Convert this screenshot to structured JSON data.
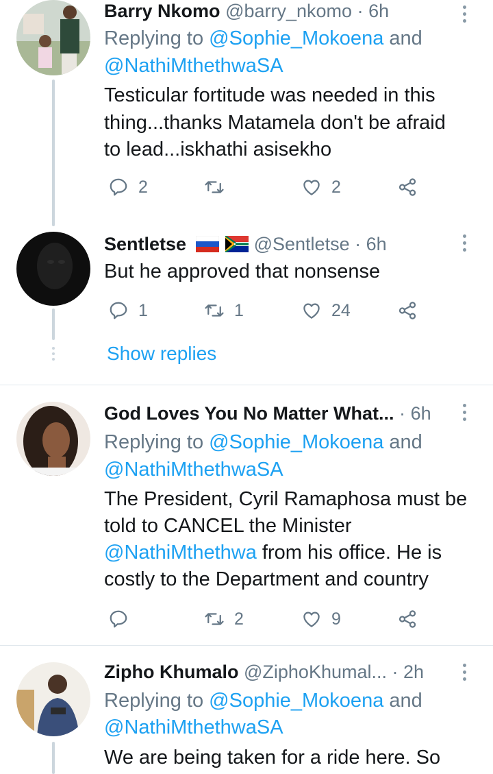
{
  "tweets": [
    {
      "name": "Barry Nkomo",
      "handle": "@barry_nkomo",
      "time": "6h",
      "reply_prefix": "Replying to",
      "reply_to_1": "@Sophie_Mokoena",
      "reply_and": "and",
      "reply_to_2": "@NathiMthethwaSA",
      "text_lines": [
        "Testicular fortitude was needed in this",
        "thing...thanks Matamela don't be afraid",
        "to lead...iskhathi asisekho"
      ],
      "replies": "2",
      "retweets": "",
      "likes": "2"
    },
    {
      "name": "Sentletse",
      "handle": "@Sentletse",
      "time": "6h",
      "text_lines": [
        "But he approved that nonsense"
      ],
      "replies": "1",
      "retweets": "1",
      "likes": "24",
      "show_replies": "Show replies"
    },
    {
      "name": "God Loves You No Matter What...",
      "handle": "",
      "time": "6h",
      "reply_prefix": "Replying to",
      "reply_to_1": "@Sophie_Mokoena",
      "reply_and": "and",
      "reply_to_2": "@NathiMthethwaSA",
      "text_line_1": "The President, Cyril Ramaphosa must be",
      "text_line_2": "told to CANCEL the Minister",
      "text_mention": "@NathiMthethwa",
      "text_line_3_rest": " from his office. He is",
      "text_line_4": "costly to the Department and country",
      "replies": "",
      "retweets": "2",
      "likes": "9"
    },
    {
      "name": "Zipho Khumalo",
      "handle": "@ZiphoKhumal...",
      "time": "2h",
      "reply_prefix": "Replying to",
      "reply_to_1": "@Sophie_Mokoena",
      "reply_and": "and",
      "reply_to_2": "@NathiMthethwaSA",
      "text_lines": [
        "We are being taken for a ride here. So"
      ]
    }
  ],
  "separator": "·",
  "icons": {
    "reply": "reply-icon",
    "retweet": "retweet-icon",
    "like": "heart-icon",
    "share": "share-icon",
    "more": "more-vertical-icon"
  },
  "colors": {
    "link": "#1da1f2",
    "secondary": "#657786",
    "thread": "#ccd6dd",
    "divider": "#e1e8ed"
  }
}
